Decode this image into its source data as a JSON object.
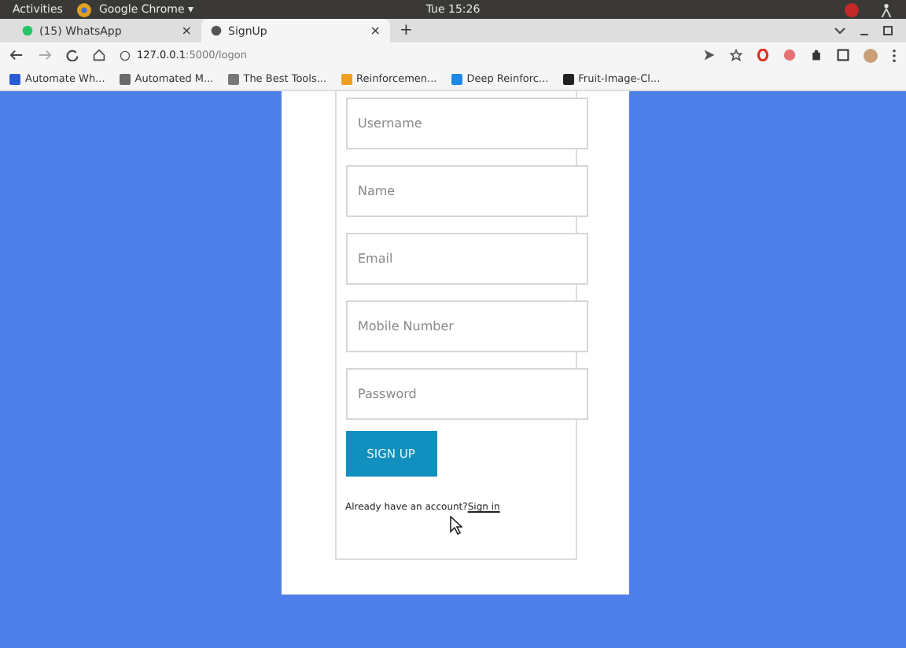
{
  "topbar": {
    "activities": "Activities",
    "app": "Google Chrome ▾",
    "clock": "Tue 15:26"
  },
  "tabs": [
    {
      "label": "(15) WhatsApp",
      "selected": false,
      "close": "×"
    },
    {
      "label": "SignUp",
      "selected": true,
      "close": "×"
    }
  ],
  "new_tab": "+",
  "address": {
    "host": "127.0.0.1",
    "path": ":5000/logon"
  },
  "bookmarks": [
    "Automate Wh...",
    "Automated M...",
    "The Best Tools...",
    "Reinforcemen...",
    "Deep Reinforc...",
    "Fruit-Image-Cl..."
  ],
  "form": {
    "fields": [
      {
        "placeholder": "Username"
      },
      {
        "placeholder": "Name"
      },
      {
        "placeholder": "Email"
      },
      {
        "placeholder": "Mobile Number"
      },
      {
        "placeholder": "Password"
      }
    ],
    "button": "SIGN UP",
    "prompt": "Already have an account?",
    "link": "Sign in"
  }
}
